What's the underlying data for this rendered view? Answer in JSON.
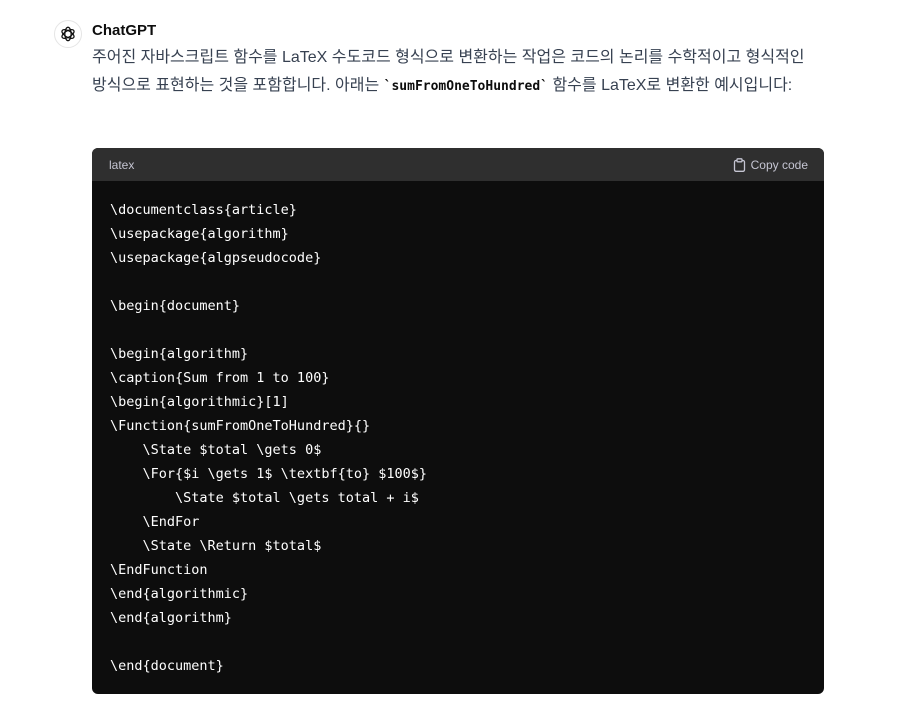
{
  "author": {
    "name": "ChatGPT",
    "avatar_icon": "openai-logo-icon"
  },
  "message": {
    "intro_part1": "주어진 자바스크립트 함수를 LaTeX 수도코드 형식으로 변환하는 작업은 코드의 논리를 수학적이고 형식적인 방식으로 표현하는 것을 포함합니다. 아래는 ",
    "inline_code": "`sumFromOneToHundred`",
    "intro_part2": " 함수를 LaTeX로 변환한 예시입니다:"
  },
  "code_block": {
    "language": "latex",
    "copy_label": "Copy code",
    "copy_icon": "clipboard-icon",
    "lines": [
      "\\documentclass{article}",
      "\\usepackage{algorithm}",
      "\\usepackage{algpseudocode}",
      "",
      "\\begin{document}",
      "",
      "\\begin{algorithm}",
      "\\caption{Sum from 1 to 100}",
      "\\begin{algorithmic}[1]",
      "\\Function{sumFromOneToHundred}{}",
      "    \\State $total \\gets 0$",
      "    \\For{$i \\gets 1$ \\textbf{to} $100$}",
      "        \\State $total \\gets total + i$",
      "    \\EndFor",
      "    \\State \\Return $total$",
      "\\EndFunction",
      "\\end{algorithmic}",
      "\\end{algorithm}",
      "",
      "\\end{document}"
    ]
  }
}
